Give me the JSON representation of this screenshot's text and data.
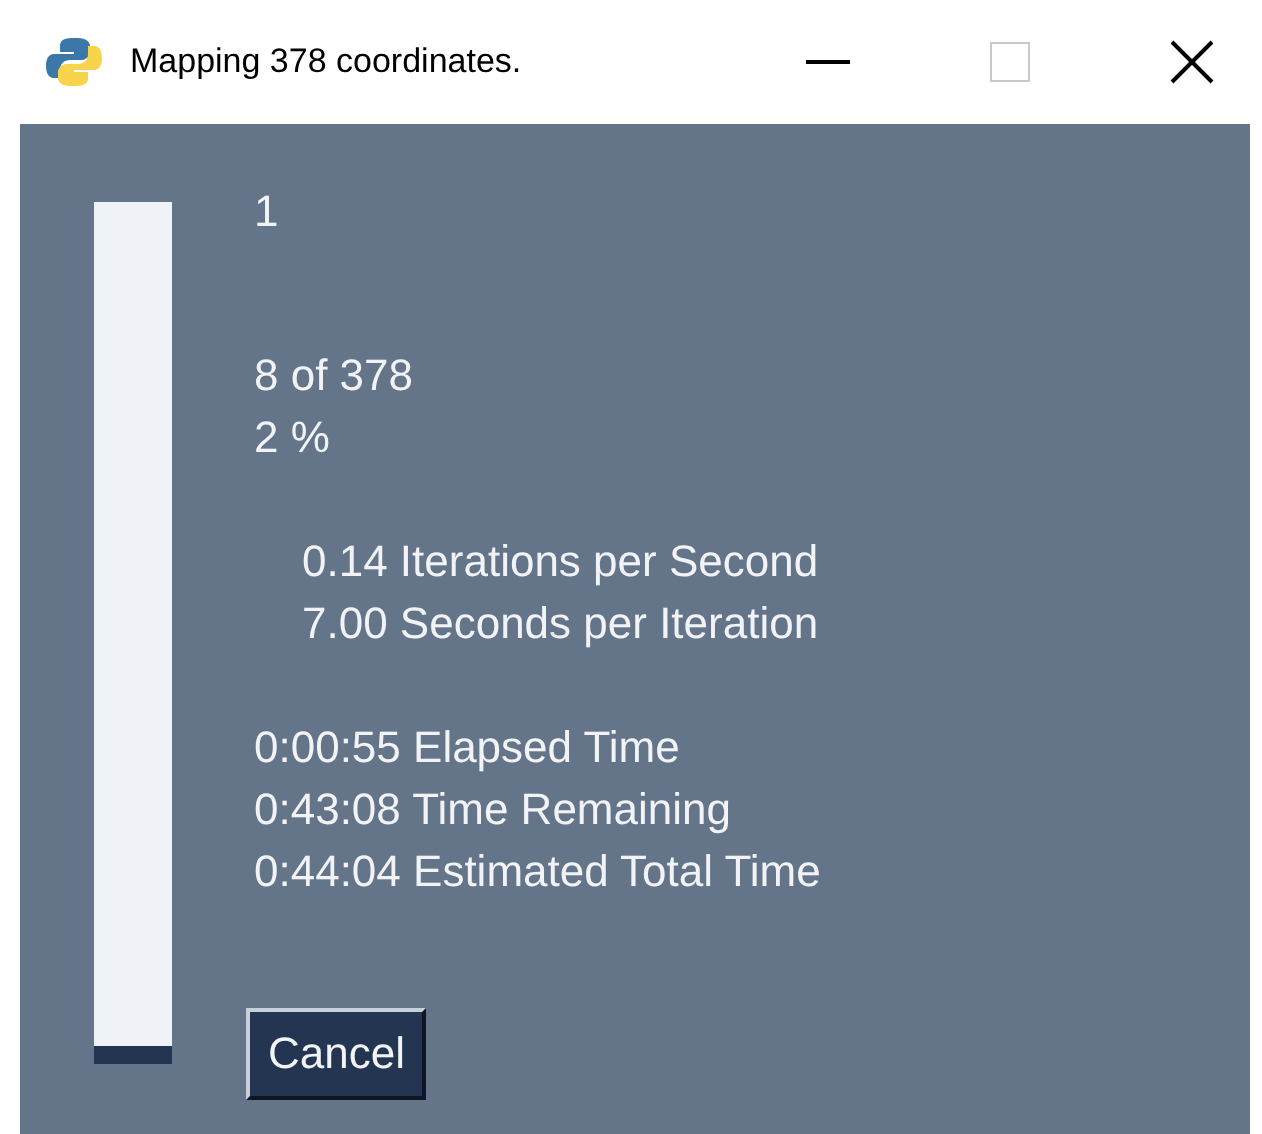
{
  "window": {
    "title": "Mapping 378 coordinates.",
    "maximize_disabled": true
  },
  "progress": {
    "level": 0.02
  },
  "blocks": [
    {
      "kind": "plain",
      "lines": [
        "1"
      ]
    },
    {
      "kind": "plain",
      "lines": [
        "8 of 378",
        "2 %"
      ]
    },
    {
      "kind": "indented",
      "lines": [
        "0.14 Iterations per Second",
        "7.00 Seconds per Iteration"
      ]
    },
    {
      "kind": "plain",
      "lines": [
        "0:00:55 Elapsed Time",
        "0:43:08 Time Remaining",
        "0:44:04 Estimated Total Time"
      ]
    }
  ],
  "buttons": [
    "Cancel"
  ]
}
